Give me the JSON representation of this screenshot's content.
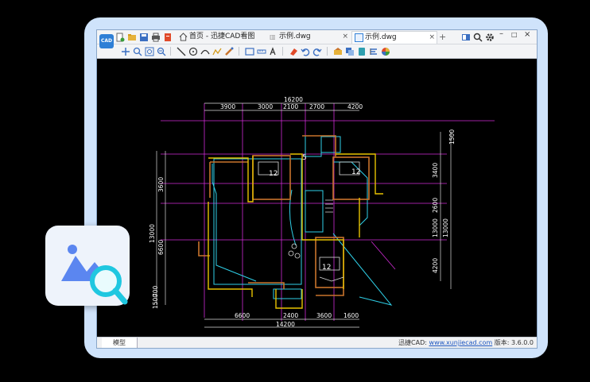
{
  "window": {
    "tabs": [
      {
        "label": "首页 - 迅捷CAD看图",
        "active": false
      },
      {
        "label": "示例.dwg",
        "active": false
      },
      {
        "label": "示例.dwg",
        "active": true
      }
    ],
    "new_tab": "+"
  },
  "drawing": {
    "dims_top": [
      "16200",
      "3900",
      "3000",
      "2100",
      "2700",
      "4200"
    ],
    "dims_bottom": [
      "6600",
      "2400",
      "3600",
      "1600",
      "14200"
    ],
    "dims_right": [
      "1500",
      "3400",
      "2600",
      "13000",
      "13000",
      "4200"
    ],
    "dims_left": [
      "3600",
      "13000",
      "6600",
      "700",
      "1500"
    ],
    "room_labels": [
      "12",
      "5",
      "12",
      "12"
    ]
  },
  "status": {
    "model_tab": "模型",
    "brand": "迅捷CAD:",
    "url": "www.xunjiecad.com",
    "version": "版本: 3.6.0.0"
  },
  "colors": {
    "accent": "#2f7fd6",
    "frame": "#cfe3fb",
    "wall_yellow": "#e8c200",
    "wall_orange": "#c9742c",
    "cyan": "#2fd0e8",
    "magenta": "#d02bd6"
  }
}
